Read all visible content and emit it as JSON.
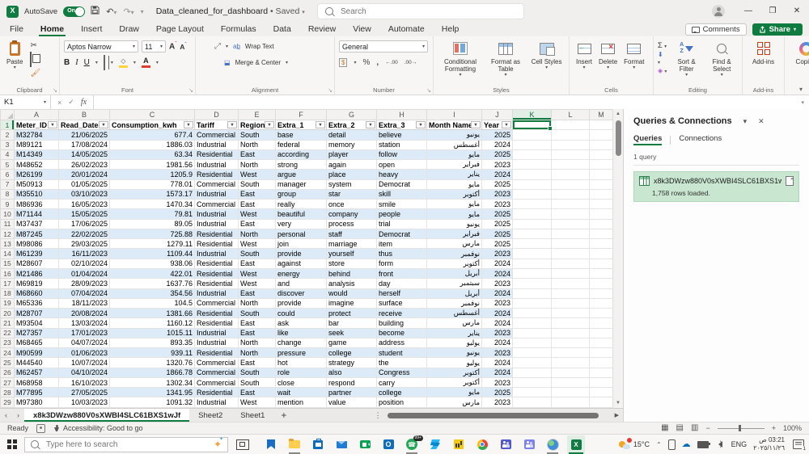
{
  "title_bar": {
    "autosave_label": "AutoSave",
    "autosave_state": "On",
    "doc_title": "Data_cleaned_for_dashboard",
    "doc_status": "• Saved",
    "search_placeholder": "Search"
  },
  "menu": {
    "tabs": [
      "File",
      "Home",
      "Insert",
      "Draw",
      "Page Layout",
      "Formulas",
      "Data",
      "Review",
      "View",
      "Automate",
      "Help"
    ],
    "active_tab": "Home",
    "comments_label": "Comments",
    "share_label": "Share"
  },
  "ribbon": {
    "clipboard_label": "Clipboard",
    "paste_label": "Paste",
    "font_label": "Font",
    "font_name": "Aptos Narrow",
    "font_size": "11",
    "alignment_label": "Alignment",
    "wrap_text_label": "Wrap Text",
    "merge_center_label": "Merge & Center",
    "number_label": "Number",
    "number_format": "General",
    "styles_label": "Styles",
    "conditional_formatting_label": "Conditional Formatting",
    "format_as_table_label": "Format as Table",
    "cell_styles_label": "Cell Styles",
    "cells_label": "Cells",
    "insert_label": "Insert",
    "delete_label": "Delete",
    "format_label": "Format",
    "editing_label": "Editing",
    "autosum_label": "Σ",
    "sort_filter_label": "Sort & Filter",
    "find_select_label": "Find & Select",
    "addins_group_label": "Add-ins",
    "addins_label": "Add-ins",
    "copilot_label": "Copilot"
  },
  "formula_bar": {
    "name_box": "K1",
    "formula_value": ""
  },
  "sheet": {
    "column_letters": [
      "A",
      "B",
      "C",
      "D",
      "E",
      "F",
      "G",
      "H",
      "I",
      "J",
      "K",
      "L",
      "M"
    ],
    "selected_cell": "K1",
    "headers": [
      "Meter_ID",
      "Read_Date",
      "Consumption_kwh",
      "Tariff",
      "Region",
      "Extra_1",
      "Extra_2",
      "Extra_3",
      "Month Name",
      "Year"
    ],
    "rows": [
      [
        "M32784",
        "21/06/2025",
        "677.4",
        "Commercial",
        "South",
        "base",
        "detail",
        "believe",
        "يونيو",
        "2025"
      ],
      [
        "M89121",
        "17/08/2024",
        "1886.03",
        "Industrial",
        "North",
        "federal",
        "memory",
        "station",
        "أغسطس",
        "2024"
      ],
      [
        "M14349",
        "14/05/2025",
        "63.34",
        "Residential",
        "East",
        "according",
        "player",
        "follow",
        "مايو",
        "2025"
      ],
      [
        "M48652",
        "26/02/2023",
        "1981.56",
        "Industrial",
        "North",
        "strong",
        "again",
        "open",
        "فبراير",
        "2023"
      ],
      [
        "M26199",
        "20/01/2024",
        "1205.9",
        "Residential",
        "West",
        "argue",
        "place",
        "heavy",
        "يناير",
        "2024"
      ],
      [
        "M50913",
        "01/05/2025",
        "778.01",
        "Commercial",
        "South",
        "manager",
        "system",
        "Democrat",
        "مايو",
        "2025"
      ],
      [
        "M35510",
        "03/10/2023",
        "1573.17",
        "Industrial",
        "East",
        "group",
        "star",
        "skill",
        "أكتوبر",
        "2023"
      ],
      [
        "M86936",
        "16/05/2023",
        "1470.34",
        "Commercial",
        "East",
        "really",
        "once",
        "smile",
        "مايو",
        "2023"
      ],
      [
        "M71144",
        "15/05/2025",
        "79.81",
        "Industrial",
        "West",
        "beautiful",
        "company",
        "people",
        "مايو",
        "2025"
      ],
      [
        "M37437",
        "17/06/2025",
        "89.05",
        "Industrial",
        "East",
        "very",
        "process",
        "trial",
        "يونيو",
        "2025"
      ],
      [
        "M87245",
        "22/02/2025",
        "725.88",
        "Residential",
        "North",
        "personal",
        "staff",
        "Democrat",
        "فبراير",
        "2025"
      ],
      [
        "M98086",
        "29/03/2025",
        "1279.11",
        "Residential",
        "West",
        "join",
        "marriage",
        "item",
        "مارس",
        "2025"
      ],
      [
        "M61239",
        "16/11/2023",
        "1109.44",
        "Industrial",
        "South",
        "provide",
        "yourself",
        "thus",
        "نوفمبر",
        "2023"
      ],
      [
        "M28607",
        "02/10/2024",
        "938.06",
        "Residential",
        "East",
        "against",
        "store",
        "form",
        "أكتوبر",
        "2024"
      ],
      [
        "M21486",
        "01/04/2024",
        "422.01",
        "Residential",
        "West",
        "energy",
        "behind",
        "front",
        "أبريل",
        "2024"
      ],
      [
        "M69819",
        "28/09/2023",
        "1637.76",
        "Residential",
        "West",
        "and",
        "analysis",
        "day",
        "سبتمبر",
        "2023"
      ],
      [
        "M68660",
        "07/04/2024",
        "354.56",
        "Industrial",
        "East",
        "discover",
        "would",
        "herself",
        "أبريل",
        "2024"
      ],
      [
        "M65336",
        "18/11/2023",
        "104.5",
        "Commercial",
        "North",
        "provide",
        "imagine",
        "surface",
        "نوفمبر",
        "2023"
      ],
      [
        "M28707",
        "20/08/2024",
        "1381.66",
        "Residential",
        "South",
        "could",
        "protect",
        "receive",
        "أغسطس",
        "2024"
      ],
      [
        "M93504",
        "13/03/2024",
        "1160.12",
        "Residential",
        "East",
        "ask",
        "bar",
        "building",
        "مارس",
        "2024"
      ],
      [
        "M27357",
        "17/01/2023",
        "1015.11",
        "Industrial",
        "East",
        "like",
        "seek",
        "become",
        "يناير",
        "2023"
      ],
      [
        "M68465",
        "04/07/2024",
        "893.35",
        "Industrial",
        "North",
        "change",
        "game",
        "address",
        "يوليو",
        "2024"
      ],
      [
        "M90599",
        "01/06/2023",
        "939.11",
        "Residential",
        "North",
        "pressure",
        "college",
        "student",
        "يونيو",
        "2023"
      ],
      [
        "M44540",
        "10/07/2024",
        "1320.76",
        "Commercial",
        "East",
        "hot",
        "strategy",
        "the",
        "يوليو",
        "2024"
      ],
      [
        "M62457",
        "04/10/2024",
        "1866.78",
        "Commercial",
        "South",
        "role",
        "also",
        "Congress",
        "أكتوبر",
        "2024"
      ],
      [
        "M68958",
        "16/10/2023",
        "1302.34",
        "Commercial",
        "South",
        "close",
        "respond",
        "carry",
        "أكتوبر",
        "2023"
      ],
      [
        "M77895",
        "27/05/2025",
        "1341.95",
        "Residential",
        "East",
        "wait",
        "partner",
        "college",
        "مايو",
        "2025"
      ],
      [
        "M97380",
        "10/03/2023",
        "1091.32",
        "Industrial",
        "West",
        "mention",
        "value",
        "position",
        "مارس",
        "2023"
      ]
    ]
  },
  "queries_panel": {
    "title": "Queries & Connections",
    "tab_queries": "Queries",
    "tab_connections": "Connections",
    "count_label": "1 query",
    "query_name": "x8k3DWzw880V0sXWBI4SLC61BXS1w...",
    "query_status": "1,758 rows loaded."
  },
  "sheet_tabs": {
    "active": "x8k3DWzw880V0sXWBI4SLC61BXS1wJf",
    "others": [
      "Sheet2",
      "Sheet1"
    ]
  },
  "status_bar": {
    "ready": "Ready",
    "accessibility": "Accessibility: Good to go",
    "zoom_level": "100%"
  },
  "taskbar": {
    "search_placeholder": "Type here to search",
    "weather_temp": "15°C",
    "whatsapp_badge": "99+",
    "language": "ENG",
    "time": "03:21 ص",
    "date": "٢٠٢٥/١١/٢٦",
    "notification_count": "1"
  },
  "colors": {
    "accent_green": "#107C41",
    "band_blue": "#DCEBF7",
    "query_card_green": "#C9E6D0"
  }
}
